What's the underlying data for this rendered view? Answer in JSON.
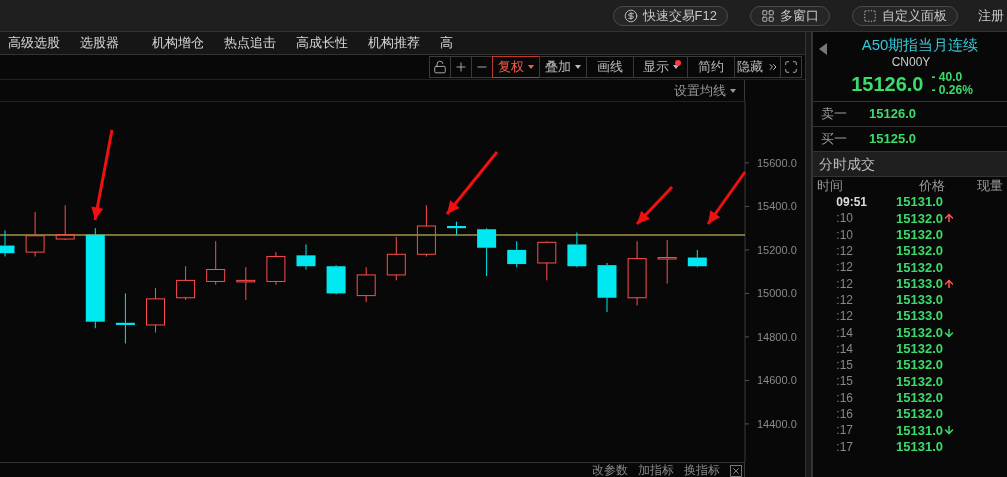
{
  "top_bar": {
    "buttons": [
      {
        "label": "快速交易F12",
        "kind": "trade"
      },
      {
        "label": "多窗口",
        "kind": "windows"
      },
      {
        "label": "自定义面板",
        "kind": "panel"
      }
    ],
    "register": "注册"
  },
  "nav_tabs": [
    {
      "label": "高级选股"
    },
    {
      "label": "选股器"
    },
    {
      "label": "机构增仓"
    },
    {
      "label": "热点追击"
    },
    {
      "label": "高成长性"
    },
    {
      "label": "机构推荐"
    },
    {
      "label": "高"
    }
  ],
  "toolbar": [
    {
      "kind": "lock",
      "selected": false,
      "dot": false
    },
    {
      "kind": "plus",
      "selected": false,
      "dot": false
    },
    {
      "kind": "minus",
      "selected": false,
      "dot": false
    },
    {
      "kind": "text",
      "label": "复权",
      "dropdown": true,
      "selected": true,
      "dot": false
    },
    {
      "kind": "text",
      "label": "叠加",
      "dropdown": true,
      "selected": false,
      "dot": false
    },
    {
      "kind": "text",
      "label": "画线",
      "dropdown": false,
      "selected": false,
      "dot": false
    },
    {
      "kind": "text",
      "label": "显示",
      "dropdown": true,
      "selected": false,
      "dot": true
    },
    {
      "kind": "text",
      "label": "简约",
      "dropdown": false,
      "selected": false,
      "dot": false
    },
    {
      "kind": "hide",
      "label": "隐藏",
      "selected": false,
      "dot": false
    },
    {
      "kind": "fullscreen",
      "selected": false,
      "dot": false
    }
  ],
  "chart": {
    "ma_settings": "设置均线",
    "y_axis_labels": [
      "15600.0",
      "15400.0",
      "15200.0",
      "15000.0",
      "14800.0",
      "14600.0",
      "14400.0"
    ]
  },
  "indicator_bar": {
    "links": [
      "改参数",
      "加指标",
      "换指标"
    ]
  },
  "quote": {
    "name": "A50期指当月连续",
    "code": "CN00Y",
    "price": "15126.0",
    "change": "- 40.0",
    "change_pct": "- 0.26%"
  },
  "order_book": [
    {
      "label": "卖一",
      "price": "15126.0"
    },
    {
      "label": "买一",
      "price": "15125.0"
    }
  ],
  "trades": {
    "title": "分时成交",
    "columns": [
      "时间",
      "价格",
      "现量"
    ],
    "rows": [
      {
        "time": "09:51",
        "emphasis": true,
        "price": "15131.0",
        "rising": false,
        "falling": false
      },
      {
        "time": ":10",
        "emphasis": false,
        "price": "15132.0",
        "rising": true,
        "falling": false
      },
      {
        "time": ":10",
        "emphasis": false,
        "price": "15132.0",
        "rising": false,
        "falling": false
      },
      {
        "time": ":12",
        "emphasis": false,
        "price": "15132.0",
        "rising": false,
        "falling": false
      },
      {
        "time": ":12",
        "emphasis": false,
        "price": "15132.0",
        "rising": false,
        "falling": false
      },
      {
        "time": ":12",
        "emphasis": false,
        "price": "15133.0",
        "rising": true,
        "falling": false
      },
      {
        "time": ":12",
        "emphasis": false,
        "price": "15133.0",
        "rising": false,
        "falling": false
      },
      {
        "time": ":12",
        "emphasis": false,
        "price": "15133.0",
        "rising": false,
        "falling": false
      },
      {
        "time": ":14",
        "emphasis": false,
        "price": "15132.0",
        "rising": false,
        "falling": true
      },
      {
        "time": ":14",
        "emphasis": false,
        "price": "15132.0",
        "rising": false,
        "falling": false
      },
      {
        "time": ":15",
        "emphasis": false,
        "price": "15132.0",
        "rising": false,
        "falling": false
      },
      {
        "time": ":15",
        "emphasis": false,
        "price": "15132.0",
        "rising": false,
        "falling": false
      },
      {
        "time": ":16",
        "emphasis": false,
        "price": "15132.0",
        "rising": false,
        "falling": false
      },
      {
        "time": ":16",
        "emphasis": false,
        "price": "15132.0",
        "rising": false,
        "falling": false
      },
      {
        "time": ":17",
        "emphasis": false,
        "price": "15131.0",
        "rising": false,
        "falling": true
      },
      {
        "time": ":17",
        "emphasis": false,
        "price": "15131.0",
        "rising": false,
        "falling": false
      }
    ]
  }
}
